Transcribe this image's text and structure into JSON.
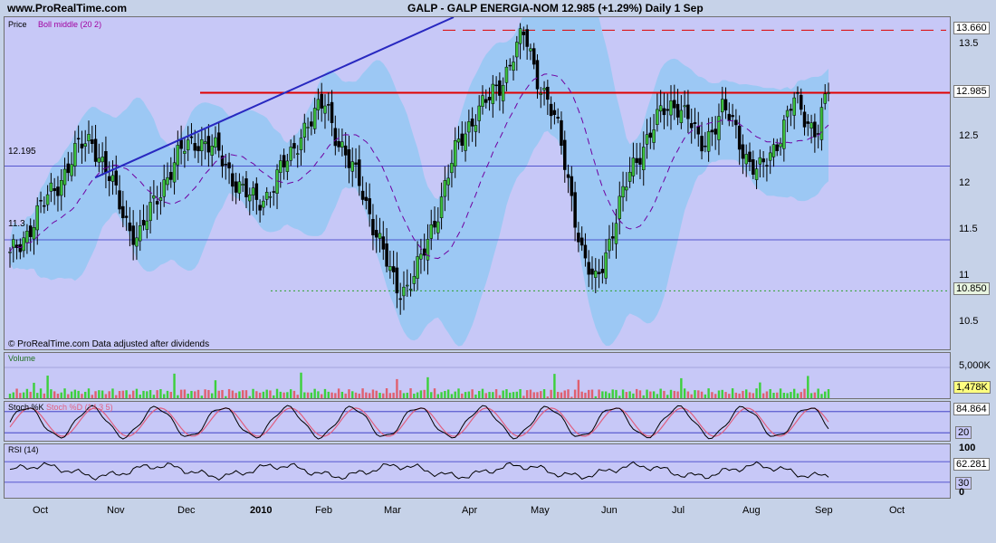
{
  "header": {
    "site": "www.ProRealTime.com",
    "title": "GALP - GALP ENERGIA-NOM    12.985 (+1.29%)    Daily  1 Sep"
  },
  "price_panel": {
    "label": "Price",
    "indicator": "Boll middle (20 2)",
    "copyright": "© ProRealTime.com  Data adjusted after dividends",
    "line_label_top": "12.195",
    "line_label_low": "11.3"
  },
  "volume_panel": {
    "label": "Volume"
  },
  "stoch_panel": {
    "label": "Stoch %K",
    "label2": "Stoch %D (14 3 5)"
  },
  "rsi_panel": {
    "label": "RSI (14)"
  },
  "colors": {
    "panel_bg": "#c7c8f7",
    "band": "#9cc8f4",
    "candle_up": "#3cc03c",
    "candle_down": "#000000",
    "resistance": "#e00000",
    "trendline": "#2828c0",
    "boll_middle": "#7000a0",
    "vol_up": "#3cd03c",
    "vol_down": "#e06070"
  },
  "chart_data": [
    {
      "type": "candlestick",
      "title": "GALP - GALP ENERGIA-NOM",
      "x_axis": {
        "labels": [
          "Oct",
          "Nov",
          "Dec",
          "2010",
          "Feb",
          "Mar",
          "Apr",
          "May",
          "Jun",
          "Jul",
          "Aug",
          "Sep",
          "Oct"
        ]
      },
      "y_axis": {
        "ticks": [
          10.5,
          11,
          11.5,
          12,
          12.5,
          13,
          13.5
        ],
        "range": [
          10.2,
          13.8
        ]
      },
      "last_price": 12.985,
      "change_pct": 1.29,
      "horizontal_lines": [
        {
          "value": 13.66,
          "label": "13.660",
          "style": "dashed",
          "color": "#e00000"
        },
        {
          "value": 12.985,
          "label": "12.985",
          "style": "solid",
          "color": "#e00000"
        },
        {
          "value": 12.195,
          "label": "12.195",
          "style": "thin",
          "color": "#3030c0"
        },
        {
          "value": 11.4,
          "label": "",
          "style": "thin",
          "color": "#3030c0"
        },
        {
          "value": 10.85,
          "label": "10.850",
          "style": "dotted",
          "color": "#30a030"
        }
      ],
      "trendline": {
        "from": {
          "x": "Apr",
          "value": 13.8
        },
        "to": {
          "x": "Oct",
          "value": 12.07
        }
      },
      "close_series": [
        11.2,
        11.4,
        11.6,
        11.8,
        12.0,
        12.2,
        12.4,
        12.5,
        12.2,
        11.9,
        11.6,
        11.4,
        11.7,
        12.0,
        12.2,
        12.4,
        12.5,
        12.4,
        12.3,
        12.1,
        11.9,
        11.8,
        11.9,
        12.1,
        12.3,
        12.6,
        12.7,
        12.9,
        12.5,
        12.2,
        12.0,
        11.6,
        11.2,
        10.9,
        10.9,
        11.1,
        11.5,
        11.9,
        12.3,
        12.6,
        12.8,
        12.9,
        13.1,
        13.4,
        13.6,
        13.2,
        12.9,
        12.5,
        11.9,
        11.2,
        10.9,
        11.3,
        11.7,
        12.1,
        12.4,
        12.6,
        12.8,
        12.9,
        12.7,
        12.4,
        12.6,
        12.8,
        12.6,
        12.3,
        12.1,
        12.3,
        12.6,
        12.9,
        12.7,
        12.6,
        12.985
      ]
    },
    {
      "type": "bar",
      "title": "Volume",
      "y_axis": {
        "ticks": [
          "5,000K"
        ]
      },
      "last_value_label": "1,478K"
    },
    {
      "type": "line",
      "title": "Stoch %K / Stoch %D (14 3 5)",
      "y_axis": {
        "ticks": [
          80,
          20
        ]
      },
      "last_value_label": "84.864"
    },
    {
      "type": "line",
      "title": "RSI (14)",
      "y_axis": {
        "ticks": [
          100,
          70,
          30,
          0
        ],
        "ticks_shown": [
          "100",
          "30",
          "0"
        ]
      },
      "last_value_label": "62.281"
    }
  ]
}
